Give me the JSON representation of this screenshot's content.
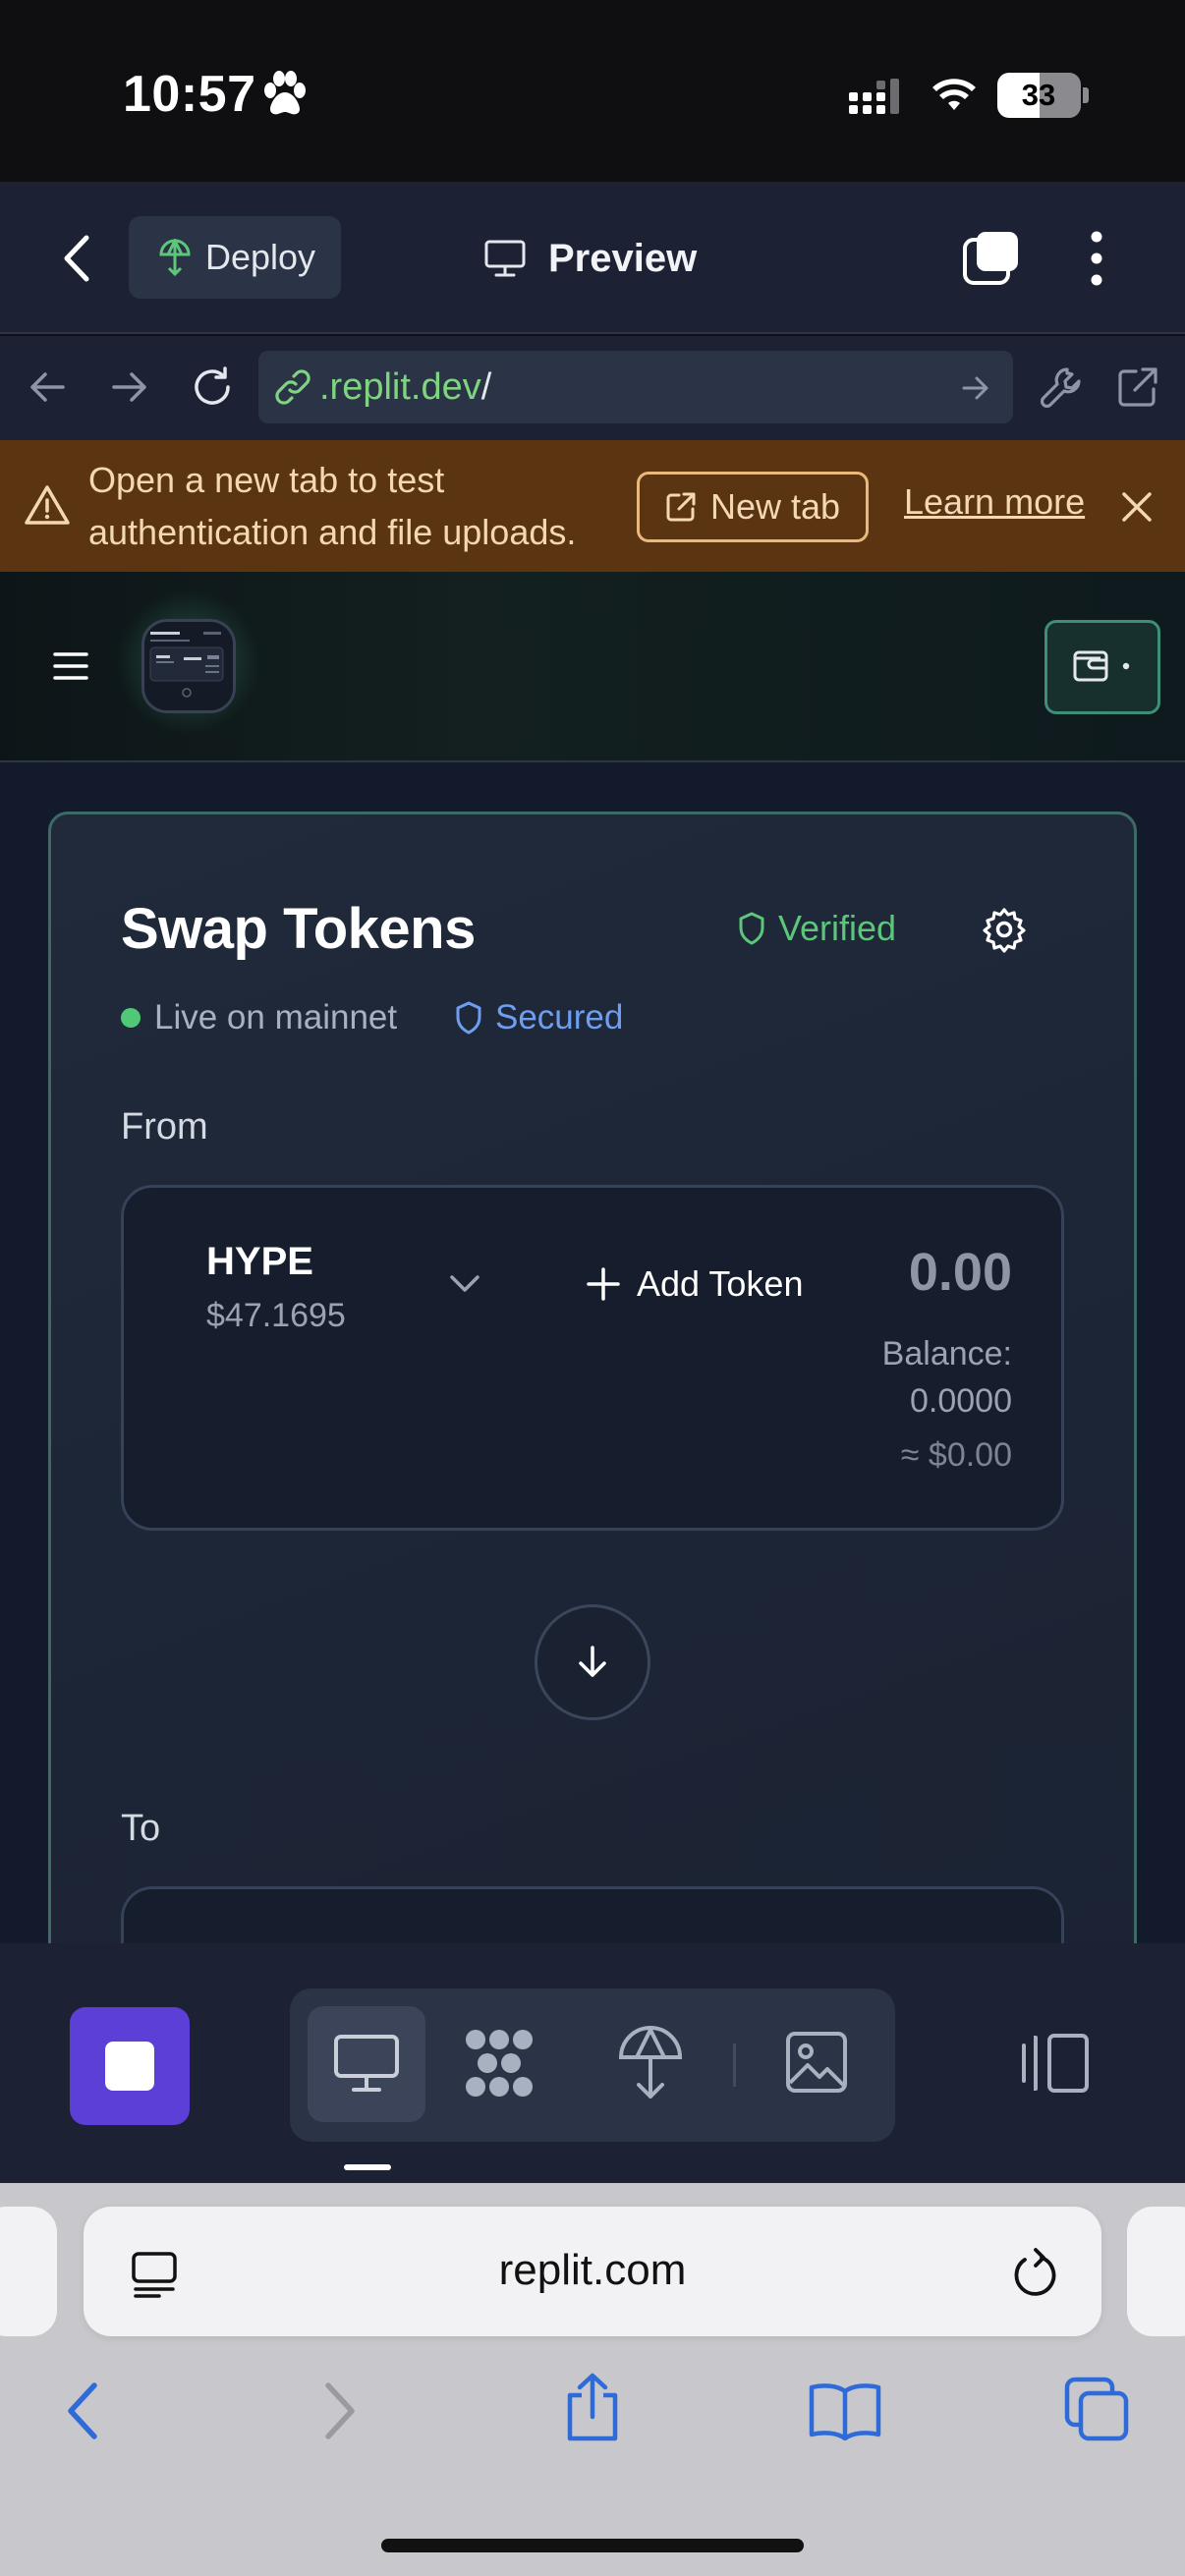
{
  "status_bar": {
    "time": "10:57",
    "battery": "33"
  },
  "replit_header": {
    "deploy_label": "Deploy",
    "preview_label": "Preview"
  },
  "browser": {
    "url_domain": ".replit.dev",
    "url_path": "/"
  },
  "banner": {
    "message_line1": "Open a new tab to test",
    "message_line2": "authentication and file uploads.",
    "new_tab_label": "New tab",
    "learn_more_label": "Learn more"
  },
  "swap": {
    "title": "Swap Tokens",
    "verified_label": "Verified",
    "live_label": "Live on mainnet",
    "secured_label": "Secured",
    "from_label": "From",
    "token_symbol": "HYPE",
    "token_price": "$47.1695",
    "add_token_label": "Add Token",
    "amount": "0.00",
    "balance_label": "Balance:",
    "balance_value": "0.0000",
    "usd_value": "≈ $0.00",
    "to_label": "To"
  },
  "safari": {
    "address": "replit.com"
  },
  "colors": {
    "accent_purple": "#5b3fd6",
    "verified_green": "#5cc77a",
    "secured_blue": "#6f9ef0",
    "banner_bg": "#5b3412",
    "card_border": "#3c6a67"
  }
}
